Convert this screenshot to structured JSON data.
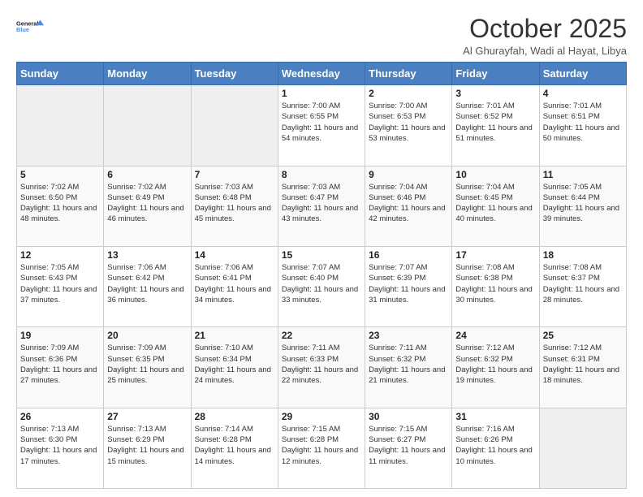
{
  "logo": {
    "line1": "General",
    "line2": "Blue",
    "icon_color": "#4a90d9"
  },
  "title": "October 2025",
  "subtitle": "Al Ghurayfah, Wadi al Hayat, Libya",
  "days_of_week": [
    "Sunday",
    "Monday",
    "Tuesday",
    "Wednesday",
    "Thursday",
    "Friday",
    "Saturday"
  ],
  "weeks": [
    [
      {
        "day": "",
        "empty": true
      },
      {
        "day": "",
        "empty": true
      },
      {
        "day": "",
        "empty": true
      },
      {
        "day": "1",
        "sunrise": "7:00 AM",
        "sunset": "6:55 PM",
        "hours": "11 hours and 54 minutes."
      },
      {
        "day": "2",
        "sunrise": "7:00 AM",
        "sunset": "6:53 PM",
        "hours": "11 hours and 53 minutes."
      },
      {
        "day": "3",
        "sunrise": "7:01 AM",
        "sunset": "6:52 PM",
        "hours": "11 hours and 51 minutes."
      },
      {
        "day": "4",
        "sunrise": "7:01 AM",
        "sunset": "6:51 PM",
        "hours": "11 hours and 50 minutes."
      }
    ],
    [
      {
        "day": "5",
        "sunrise": "7:02 AM",
        "sunset": "6:50 PM",
        "hours": "11 hours and 48 minutes."
      },
      {
        "day": "6",
        "sunrise": "7:02 AM",
        "sunset": "6:49 PM",
        "hours": "11 hours and 46 minutes."
      },
      {
        "day": "7",
        "sunrise": "7:03 AM",
        "sunset": "6:48 PM",
        "hours": "11 hours and 45 minutes."
      },
      {
        "day": "8",
        "sunrise": "7:03 AM",
        "sunset": "6:47 PM",
        "hours": "11 hours and 43 minutes."
      },
      {
        "day": "9",
        "sunrise": "7:04 AM",
        "sunset": "6:46 PM",
        "hours": "11 hours and 42 minutes."
      },
      {
        "day": "10",
        "sunrise": "7:04 AM",
        "sunset": "6:45 PM",
        "hours": "11 hours and 40 minutes."
      },
      {
        "day": "11",
        "sunrise": "7:05 AM",
        "sunset": "6:44 PM",
        "hours": "11 hours and 39 minutes."
      }
    ],
    [
      {
        "day": "12",
        "sunrise": "7:05 AM",
        "sunset": "6:43 PM",
        "hours": "11 hours and 37 minutes."
      },
      {
        "day": "13",
        "sunrise": "7:06 AM",
        "sunset": "6:42 PM",
        "hours": "11 hours and 36 minutes."
      },
      {
        "day": "14",
        "sunrise": "7:06 AM",
        "sunset": "6:41 PM",
        "hours": "11 hours and 34 minutes."
      },
      {
        "day": "15",
        "sunrise": "7:07 AM",
        "sunset": "6:40 PM",
        "hours": "11 hours and 33 minutes."
      },
      {
        "day": "16",
        "sunrise": "7:07 AM",
        "sunset": "6:39 PM",
        "hours": "11 hours and 31 minutes."
      },
      {
        "day": "17",
        "sunrise": "7:08 AM",
        "sunset": "6:38 PM",
        "hours": "11 hours and 30 minutes."
      },
      {
        "day": "18",
        "sunrise": "7:08 AM",
        "sunset": "6:37 PM",
        "hours": "11 hours and 28 minutes."
      }
    ],
    [
      {
        "day": "19",
        "sunrise": "7:09 AM",
        "sunset": "6:36 PM",
        "hours": "11 hours and 27 minutes."
      },
      {
        "day": "20",
        "sunrise": "7:09 AM",
        "sunset": "6:35 PM",
        "hours": "11 hours and 25 minutes."
      },
      {
        "day": "21",
        "sunrise": "7:10 AM",
        "sunset": "6:34 PM",
        "hours": "11 hours and 24 minutes."
      },
      {
        "day": "22",
        "sunrise": "7:11 AM",
        "sunset": "6:33 PM",
        "hours": "11 hours and 22 minutes."
      },
      {
        "day": "23",
        "sunrise": "7:11 AM",
        "sunset": "6:32 PM",
        "hours": "11 hours and 21 minutes."
      },
      {
        "day": "24",
        "sunrise": "7:12 AM",
        "sunset": "6:32 PM",
        "hours": "11 hours and 19 minutes."
      },
      {
        "day": "25",
        "sunrise": "7:12 AM",
        "sunset": "6:31 PM",
        "hours": "11 hours and 18 minutes."
      }
    ],
    [
      {
        "day": "26",
        "sunrise": "7:13 AM",
        "sunset": "6:30 PM",
        "hours": "11 hours and 17 minutes."
      },
      {
        "day": "27",
        "sunrise": "7:13 AM",
        "sunset": "6:29 PM",
        "hours": "11 hours and 15 minutes."
      },
      {
        "day": "28",
        "sunrise": "7:14 AM",
        "sunset": "6:28 PM",
        "hours": "11 hours and 14 minutes."
      },
      {
        "day": "29",
        "sunrise": "7:15 AM",
        "sunset": "6:28 PM",
        "hours": "11 hours and 12 minutes."
      },
      {
        "day": "30",
        "sunrise": "7:15 AM",
        "sunset": "6:27 PM",
        "hours": "11 hours and 11 minutes."
      },
      {
        "day": "31",
        "sunrise": "7:16 AM",
        "sunset": "6:26 PM",
        "hours": "11 hours and 10 minutes."
      },
      {
        "day": "",
        "empty": true
      }
    ]
  ]
}
